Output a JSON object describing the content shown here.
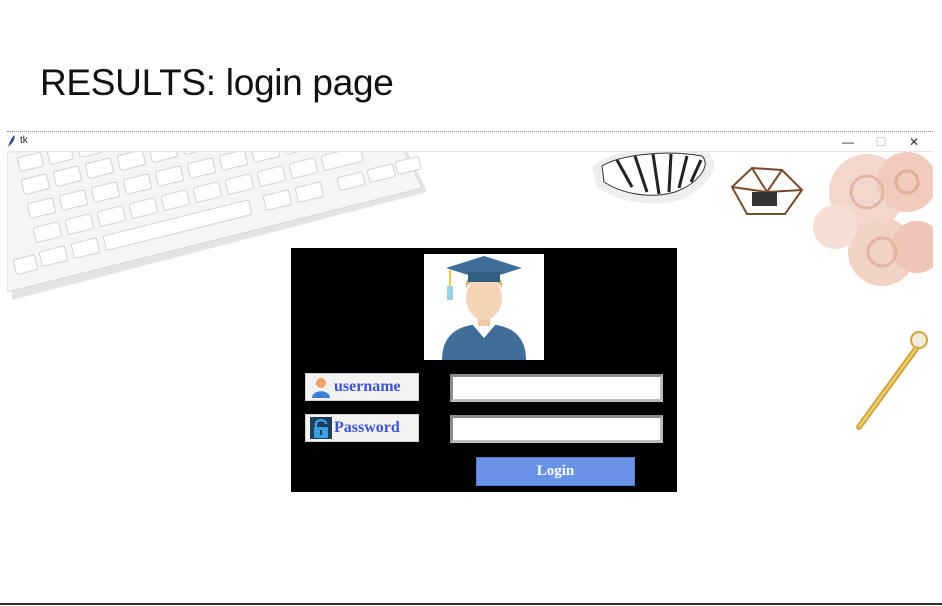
{
  "slide": {
    "title": "RESULTS: login page"
  },
  "window": {
    "title": "tk",
    "controls": {
      "minimize": "—",
      "maximize": "☐",
      "close": "✕"
    }
  },
  "login": {
    "avatar_icon": "graduate-avatar-icon",
    "username_label": "username",
    "username_icon": "user-icon",
    "username_value": "",
    "password_label": "Password",
    "password_icon": "padlock-icon",
    "password_value": "",
    "button_label": "Login"
  },
  "colors": {
    "panel": "#000000",
    "label_text": "#3b55d0",
    "button": "#6a93e8",
    "button_text": "#ffffff"
  }
}
